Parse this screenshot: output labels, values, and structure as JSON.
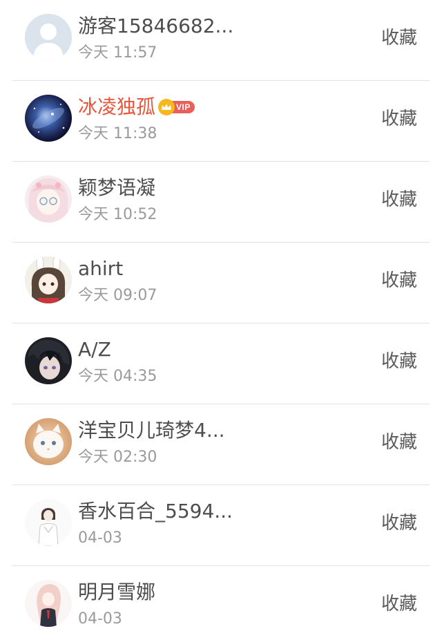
{
  "items": [
    {
      "name": "游客15846682...",
      "time": "今天 11:57",
      "action": "收藏",
      "vip": false,
      "avatar": "default-avatar"
    },
    {
      "name": "冰凌独孤",
      "time": "今天 11:38",
      "action": "收藏",
      "vip": true,
      "vip_label": "VIP",
      "avatar": "galaxy-avatar"
    },
    {
      "name": "颖梦语凝",
      "time": "今天 10:52",
      "action": "收藏",
      "vip": false,
      "avatar": "anime-girl-glasses-avatar"
    },
    {
      "name": "ahirt",
      "time": "今天 09:07",
      "action": "收藏",
      "vip": false,
      "avatar": "bunny-girl-avatar"
    },
    {
      "name": "A/Z",
      "time": "今天 04:35",
      "action": "收藏",
      "vip": false,
      "avatar": "anime-boy-avatar"
    },
    {
      "name": "洋宝贝儿琦梦4...",
      "time": "今天 02:30",
      "action": "收藏",
      "vip": false,
      "avatar": "white-cat-avatar"
    },
    {
      "name": "香水百合_5594...",
      "time": "04-03",
      "action": "收藏",
      "vip": false,
      "avatar": "sketch-girl-avatar"
    },
    {
      "name": "明月雪娜",
      "time": "04-03",
      "action": "收藏",
      "vip": false,
      "avatar": "pink-hair-girl-avatar"
    }
  ],
  "colors": {
    "vip_name": "#e8553b",
    "vip_badge": "#e9605a",
    "crown": "#f5b91e",
    "divider": "#e3e3e3"
  }
}
